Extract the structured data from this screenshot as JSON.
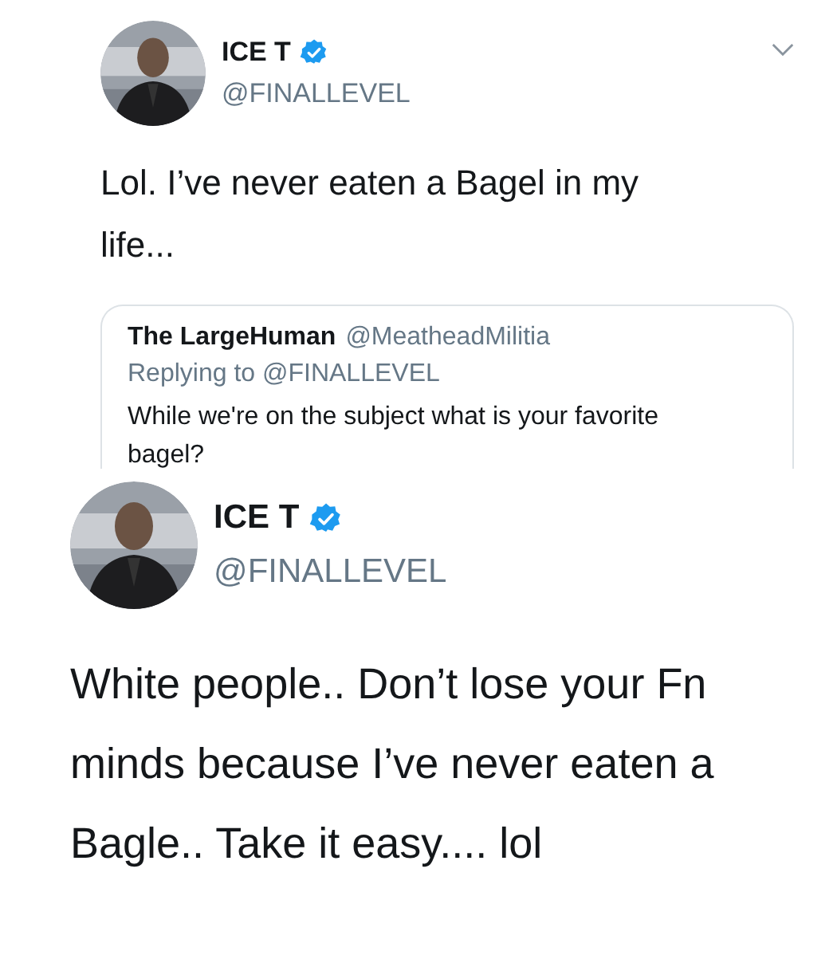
{
  "tweets": [
    {
      "kind": "compact",
      "author": {
        "name": "ICE T",
        "verified": true,
        "handle": "@FINALLEVEL"
      },
      "menu": true,
      "text": "Lol. I’ve never eaten a Bagel in my life...",
      "quoted": {
        "name": "The LargeHuman",
        "handle": "@MeatheadMilitia",
        "replying_to": "Replying to @FINALLEVEL",
        "text": "While we're on the subject what is your favorite bagel?"
      }
    },
    {
      "kind": "large",
      "author": {
        "name": "ICE T",
        "verified": true,
        "handle": "@FINALLEVEL"
      },
      "menu": false,
      "text": "White people.. Don’t lose your Fn minds because I’ve never eaten a Bagle.. Take it easy.... lol"
    }
  ]
}
